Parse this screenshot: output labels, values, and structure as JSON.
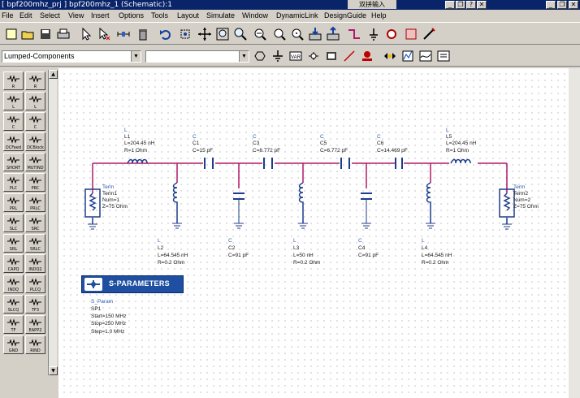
{
  "window": {
    "title": "[ bpf200mhz_prj ] bpf200mhz_1 (Schematic):1",
    "ime_text": "双拼输入",
    "buttons": {
      "minimize": "_",
      "restore": "❐",
      "help": "?",
      "close": "✕"
    }
  },
  "menu": [
    "File",
    "Edit",
    "Select",
    "View",
    "Insert",
    "Options",
    "Tools",
    "Layout",
    "Simulate",
    "Window",
    "DynamicLink",
    "DesignGuide",
    "Help"
  ],
  "library_combo": {
    "value": "Lumped-Components"
  },
  "component_combo": {
    "value": ""
  },
  "palette": [
    "R",
    "R",
    "L",
    "L",
    "C",
    "C",
    "DCFeed",
    "DCBlock",
    "SHORT",
    "MUTIND",
    "PLC",
    "PRC",
    "PRL",
    "PRLC",
    "SLC",
    "SRC",
    "SRL",
    "SRLC",
    "CAPQ",
    "INDQ2",
    "INDQ",
    "PLCQ",
    "SLCQ",
    "TF3",
    "TF",
    "EAPP2",
    "GND",
    "RIND"
  ],
  "schematic": {
    "term1": {
      "type": "Term",
      "name": "Term1",
      "num": "Num=1",
      "z": "Z=75 Ohm"
    },
    "term2": {
      "type": "Term",
      "name": "Term2",
      "num": "Num=2",
      "z": "Z=75 Ohm"
    },
    "l1": {
      "type": "L",
      "name": "L1",
      "l": "L=204.45 nH",
      "r": "R=1 Ohm"
    },
    "c1": {
      "type": "C",
      "name": "C1",
      "c": "C=15 pF"
    },
    "c3": {
      "type": "C",
      "name": "C3",
      "c": "C=6.772 pF"
    },
    "c5": {
      "type": "C",
      "name": "C5",
      "c": "C=6.772 pF"
    },
    "c6": {
      "type": "C",
      "name": "C6",
      "c": "C=14.469 pF"
    },
    "l5": {
      "type": "L",
      "name": "L5",
      "l": "L=204.45 nH",
      "r": "R=1 Ohm"
    },
    "l2": {
      "type": "L",
      "name": "L2",
      "l": "L=64.545 nH",
      "r": "R=0.2 Ohm"
    },
    "c2": {
      "type": "C",
      "name": "C2",
      "c": "C=91 pF"
    },
    "l3": {
      "type": "L",
      "name": "L3",
      "l": "L=50 nH",
      "r": "R=0.2 Ohm"
    },
    "c4": {
      "type": "C",
      "name": "C4",
      "c": "C=91 pF"
    },
    "l4": {
      "type": "L",
      "name": "L4",
      "l": "L=64.545 nH",
      "r": "R=0.2 Ohm"
    },
    "sparam": {
      "title": "S-PARAMETERS",
      "type": "S_Param",
      "name": "SP1",
      "start": "Start=150 MHz",
      "stop": "Stop=250 MHz",
      "step": "Step=1.0 MHz"
    }
  },
  "colors": {
    "wire": "#b0186a",
    "component": "#1c3d8a",
    "label": "#1a1a1a",
    "typeLabel": "#2a5aa8"
  }
}
